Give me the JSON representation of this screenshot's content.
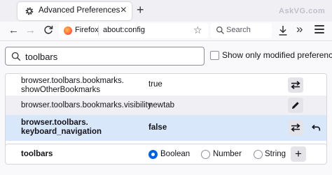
{
  "tab": {
    "title": "Advanced Preferences",
    "close": "×",
    "new_tab": "+"
  },
  "watermark": "AskVG.com",
  "nav": {
    "back": "←",
    "forward": "→",
    "identity_label": "Firefox",
    "url": "about:config",
    "search_placeholder": "Search"
  },
  "filter": {
    "search_value": "toolbars",
    "modified_only_label": "Show only modified preferences"
  },
  "prefs": [
    {
      "name_line1": "browser.toolbars.bookmarks.",
      "name_line2": "showOtherBookmarks",
      "value": "true",
      "type": "boolean",
      "modified": false
    },
    {
      "name_line1": "browser.toolbars.bookmarks.visibility",
      "name_line2": "",
      "value": "newtab",
      "type": "string",
      "modified": false
    },
    {
      "name_line1": "browser.toolbars.",
      "name_line2": "keyboard_navigation",
      "value": "false",
      "type": "boolean",
      "modified": true
    }
  ],
  "new_pref": {
    "name": "toolbars",
    "types": [
      "Boolean",
      "Number",
      "String"
    ],
    "selected_type": "Boolean",
    "add_label": "+"
  },
  "colors": {
    "accent": "#0061e0",
    "modified_row": "#d9e7fb"
  }
}
